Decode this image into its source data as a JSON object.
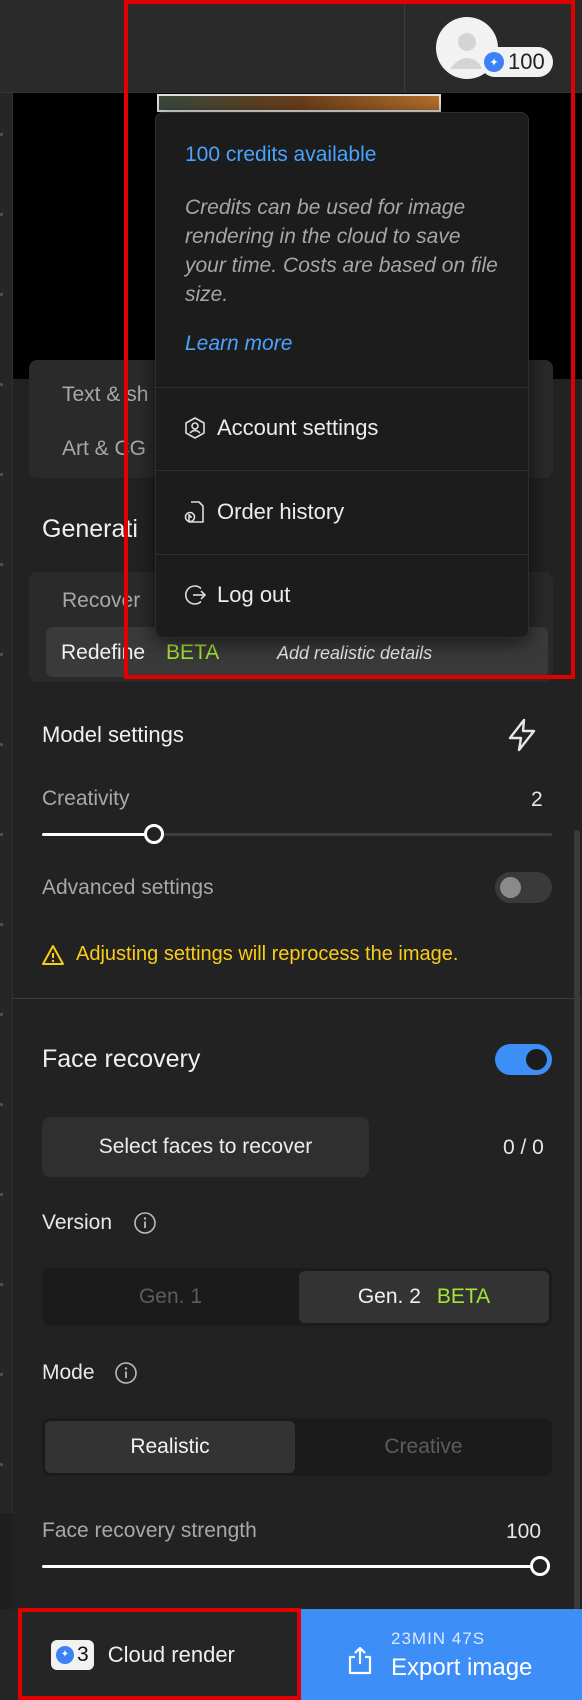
{
  "header": {
    "credits_count": "100"
  },
  "sidebar_types": {
    "item_text_partial": "Text & sh",
    "item_art_partial": "Art & CG"
  },
  "generation": {
    "title_partial": "Generati",
    "recover_partial": "Recover",
    "redefine_label": "Redefine",
    "redefine_badge": "BETA",
    "redefine_hint": "Add realistic details"
  },
  "model_settings": {
    "title": "Model settings",
    "creativity_label": "Creativity",
    "creativity_value": "2",
    "creativity_fraction": 0.22,
    "advanced_label": "Advanced settings",
    "advanced_enabled": false,
    "warning": "Adjusting settings will reprocess the image."
  },
  "face_recovery": {
    "title": "Face recovery",
    "enabled": true,
    "select_button": "Select faces to recover",
    "selected_count": "0 / 0",
    "version_label": "Version",
    "version_options": [
      "Gen. 1",
      "Gen. 2"
    ],
    "version_badge": "BETA",
    "version_selected": "Gen. 2",
    "mode_label": "Mode",
    "mode_options": [
      "Realistic",
      "Creative"
    ],
    "mode_selected": "Realistic",
    "strength_label": "Face recovery strength",
    "strength_value": "100",
    "strength_fraction": 1.0
  },
  "bottom_bar": {
    "cloud_credits": "3",
    "cloud_label": "Cloud render",
    "export_time": "23MIN 47S",
    "export_label": "Export image"
  },
  "dropdown": {
    "heading": "100 credits available",
    "description": "Credits can be used for image rendering in the cloud to save your time. Costs are based on file size.",
    "learn_more": "Learn more",
    "items": [
      {
        "label": "Account settings",
        "icon": "account-icon"
      },
      {
        "label": "Order history",
        "icon": "order-history-icon"
      },
      {
        "label": "Log out",
        "icon": "logout-icon"
      }
    ]
  },
  "colors": {
    "accent_blue": "#3d8ef7",
    "link_blue": "#4aa3ff",
    "beta_green": "#a3e635",
    "warning_yellow": "#facc15",
    "highlight_red": "#e00000"
  }
}
